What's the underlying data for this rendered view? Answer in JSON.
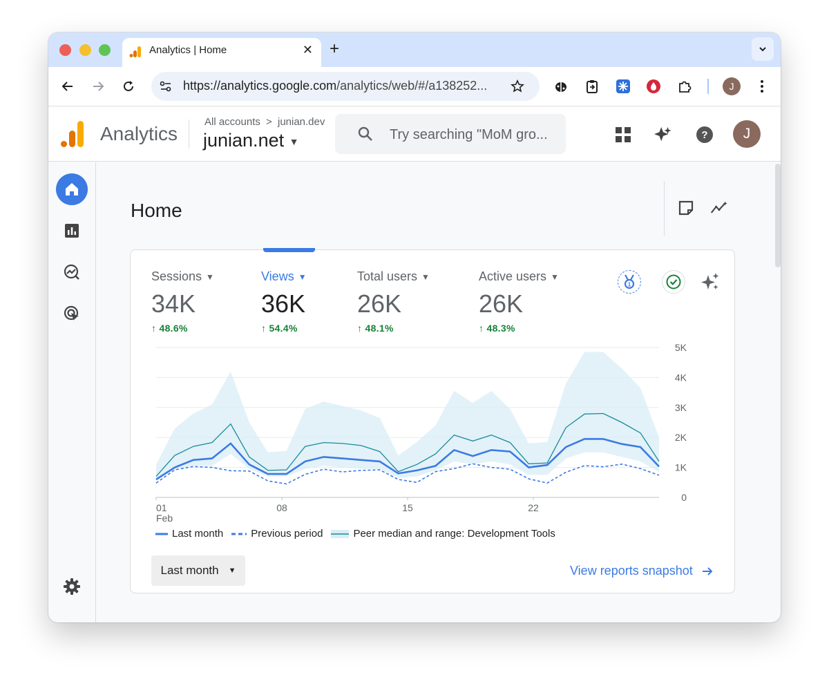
{
  "browser": {
    "tab_title": "Analytics | Home",
    "tab_close": "✕",
    "new_tab": "+",
    "url_host": "https://analytics.google.com",
    "url_path": "/analytics/web/#/a138252...",
    "profile_initial": "J"
  },
  "header": {
    "product_name": "Analytics",
    "breadcrumb_root": "All accounts",
    "breadcrumb_separator": ">",
    "breadcrumb_account": "junian.dev",
    "property": "junian.net",
    "search_placeholder": "Try searching \"MoM gro...",
    "avatar_initial": "J"
  },
  "page": {
    "title": "Home"
  },
  "metrics": [
    {
      "label": "Sessions",
      "value": "34K",
      "delta": "48.6%"
    },
    {
      "label": "Views",
      "value": "36K",
      "delta": "54.4%",
      "active": true
    },
    {
      "label": "Total users",
      "value": "26K",
      "delta": "48.1%"
    },
    {
      "label": "Active users",
      "value": "26K",
      "delta": "48.3%"
    }
  ],
  "chart_data": {
    "type": "line",
    "x_tick_labels": [
      "01",
      "08",
      "15",
      "22"
    ],
    "x_sub_label": "Feb",
    "y_tick_labels": [
      "0",
      "1K",
      "2K",
      "3K",
      "4K",
      "5K"
    ],
    "ylim": [
      0,
      5000
    ],
    "x": [
      1,
      2,
      3,
      4,
      5,
      6,
      7,
      8,
      9,
      10,
      11,
      12,
      13,
      14,
      15,
      16,
      17,
      18,
      19,
      20,
      21,
      22,
      23,
      24,
      25,
      26,
      27,
      28,
      29
    ],
    "series": [
      {
        "name": "Last month",
        "style": "solid",
        "color": "#3c7ae4",
        "values": [
          600,
          1000,
          1250,
          1300,
          1800,
          1100,
          780,
          780,
          1200,
          1350,
          1300,
          1250,
          1200,
          800,
          900,
          1050,
          1580,
          1380,
          1580,
          1530,
          1000,
          1080,
          1680,
          1950,
          1950,
          1780,
          1680,
          1030
        ]
      },
      {
        "name": "Previous period",
        "style": "dashed",
        "color": "#3c7ae4",
        "values": [
          480,
          920,
          1030,
          1000,
          890,
          880,
          550,
          450,
          770,
          940,
          850,
          900,
          920,
          600,
          500,
          860,
          960,
          1120,
          1000,
          940,
          620,
          480,
          840,
          1060,
          1020,
          1110,
          960,
          740
        ]
      },
      {
        "name": "Peer median and range: Development Tools",
        "style": "band",
        "color": "#1a8a9a",
        "median": [
          700,
          1400,
          1700,
          1830,
          2450,
          1350,
          900,
          920,
          1700,
          1830,
          1800,
          1730,
          1530,
          860,
          1100,
          1450,
          2080,
          1880,
          2080,
          1830,
          1120,
          1150,
          2330,
          2780,
          2800,
          2500,
          2150,
          1200
        ],
        "upper": [
          1100,
          2300,
          2800,
          3100,
          4200,
          2500,
          1500,
          1550,
          2950,
          3200,
          3050,
          2900,
          2650,
          1400,
          1850,
          2400,
          3550,
          3150,
          3550,
          2950,
          1800,
          1850,
          3800,
          4850,
          4850,
          4300,
          3650,
          2000
        ],
        "lower": [
          550,
          950,
          1050,
          1050,
          1450,
          950,
          700,
          700,
          950,
          1050,
          1000,
          950,
          950,
          650,
          700,
          900,
          1200,
          1100,
          1200,
          1100,
          750,
          750,
          1300,
          1500,
          1500,
          1350,
          1200,
          850
        ]
      }
    ],
    "grid": true,
    "legend_position": "bottom"
  },
  "controls": {
    "date_range": "Last month",
    "snapshot_link": "View reports snapshot"
  },
  "colors": {
    "accent": "#3c7ae4",
    "positive": "#188038",
    "band_fill": "#d8eef5",
    "median_line": "#1a8a9a"
  }
}
